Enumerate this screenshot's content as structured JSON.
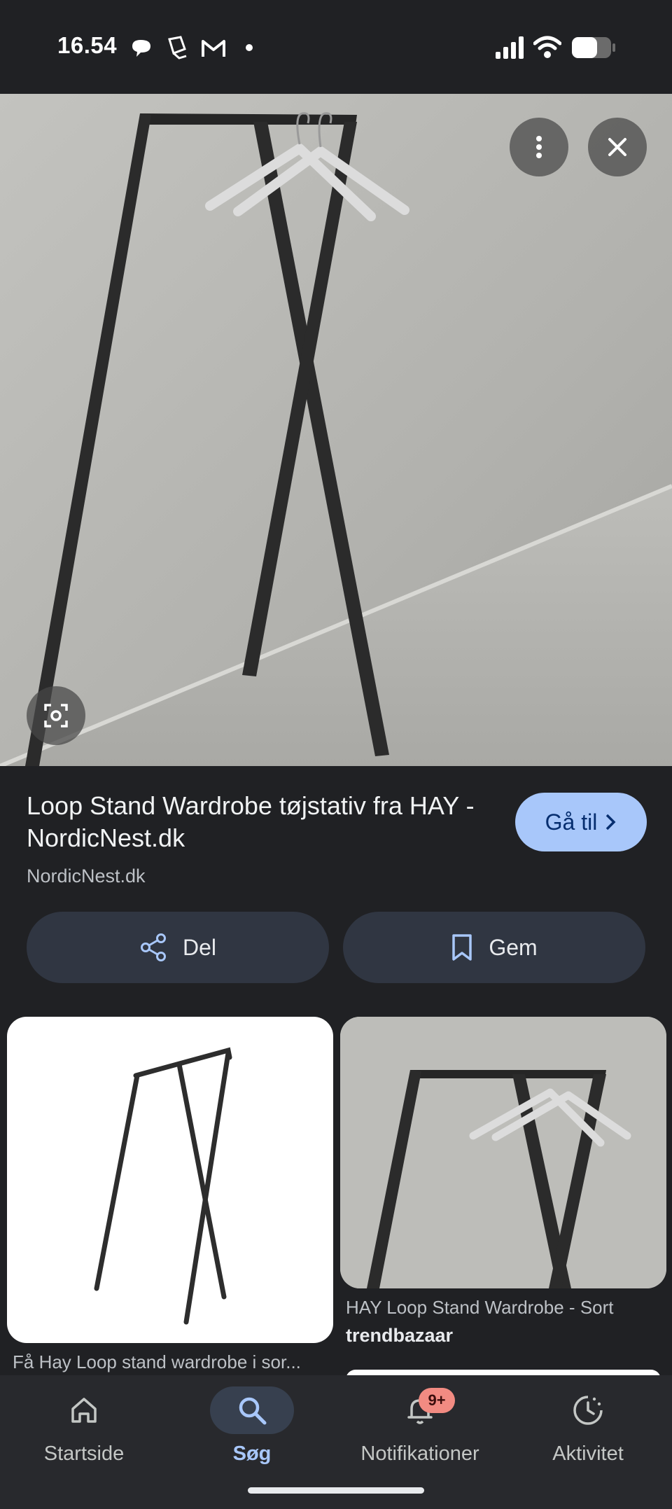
{
  "status_bar": {
    "time": "16.54",
    "icons": [
      "chat-bubble-icon",
      "notification-app-icon",
      "gmail-icon",
      "dot-icon",
      "signal-icon",
      "wifi-icon",
      "battery-icon"
    ]
  },
  "image_viewer": {
    "menu_icon": "more-vert-icon",
    "close_icon": "close-icon",
    "lens_icon": "lens-icon"
  },
  "result": {
    "title": "Loop Stand Wardrobe tøjstativ fra HAY - NordicNest.dk",
    "source": "NordicNest.dk",
    "goto_label": "Gå til"
  },
  "actions": {
    "share_label": "Del",
    "save_label": "Gem"
  },
  "related": [
    {
      "caption": "Få Hay Loop stand wardrobe i sor...",
      "source": ""
    },
    {
      "caption": "HAY Loop Stand Wardrobe - Sort",
      "source": "trendbazaar"
    }
  ],
  "bottom_nav": {
    "items": [
      {
        "label": "Startside",
        "icon": "home-icon"
      },
      {
        "label": "Søg",
        "icon": "search-icon"
      },
      {
        "label": "Notifikationer",
        "icon": "bell-icon"
      },
      {
        "label": "Aktivitet",
        "icon": "activity-icon"
      }
    ],
    "badge": "9+"
  },
  "colors": {
    "background": "#202124",
    "accent": "#a8c7fa",
    "pill": "#303642",
    "badge": "#f28b82"
  }
}
